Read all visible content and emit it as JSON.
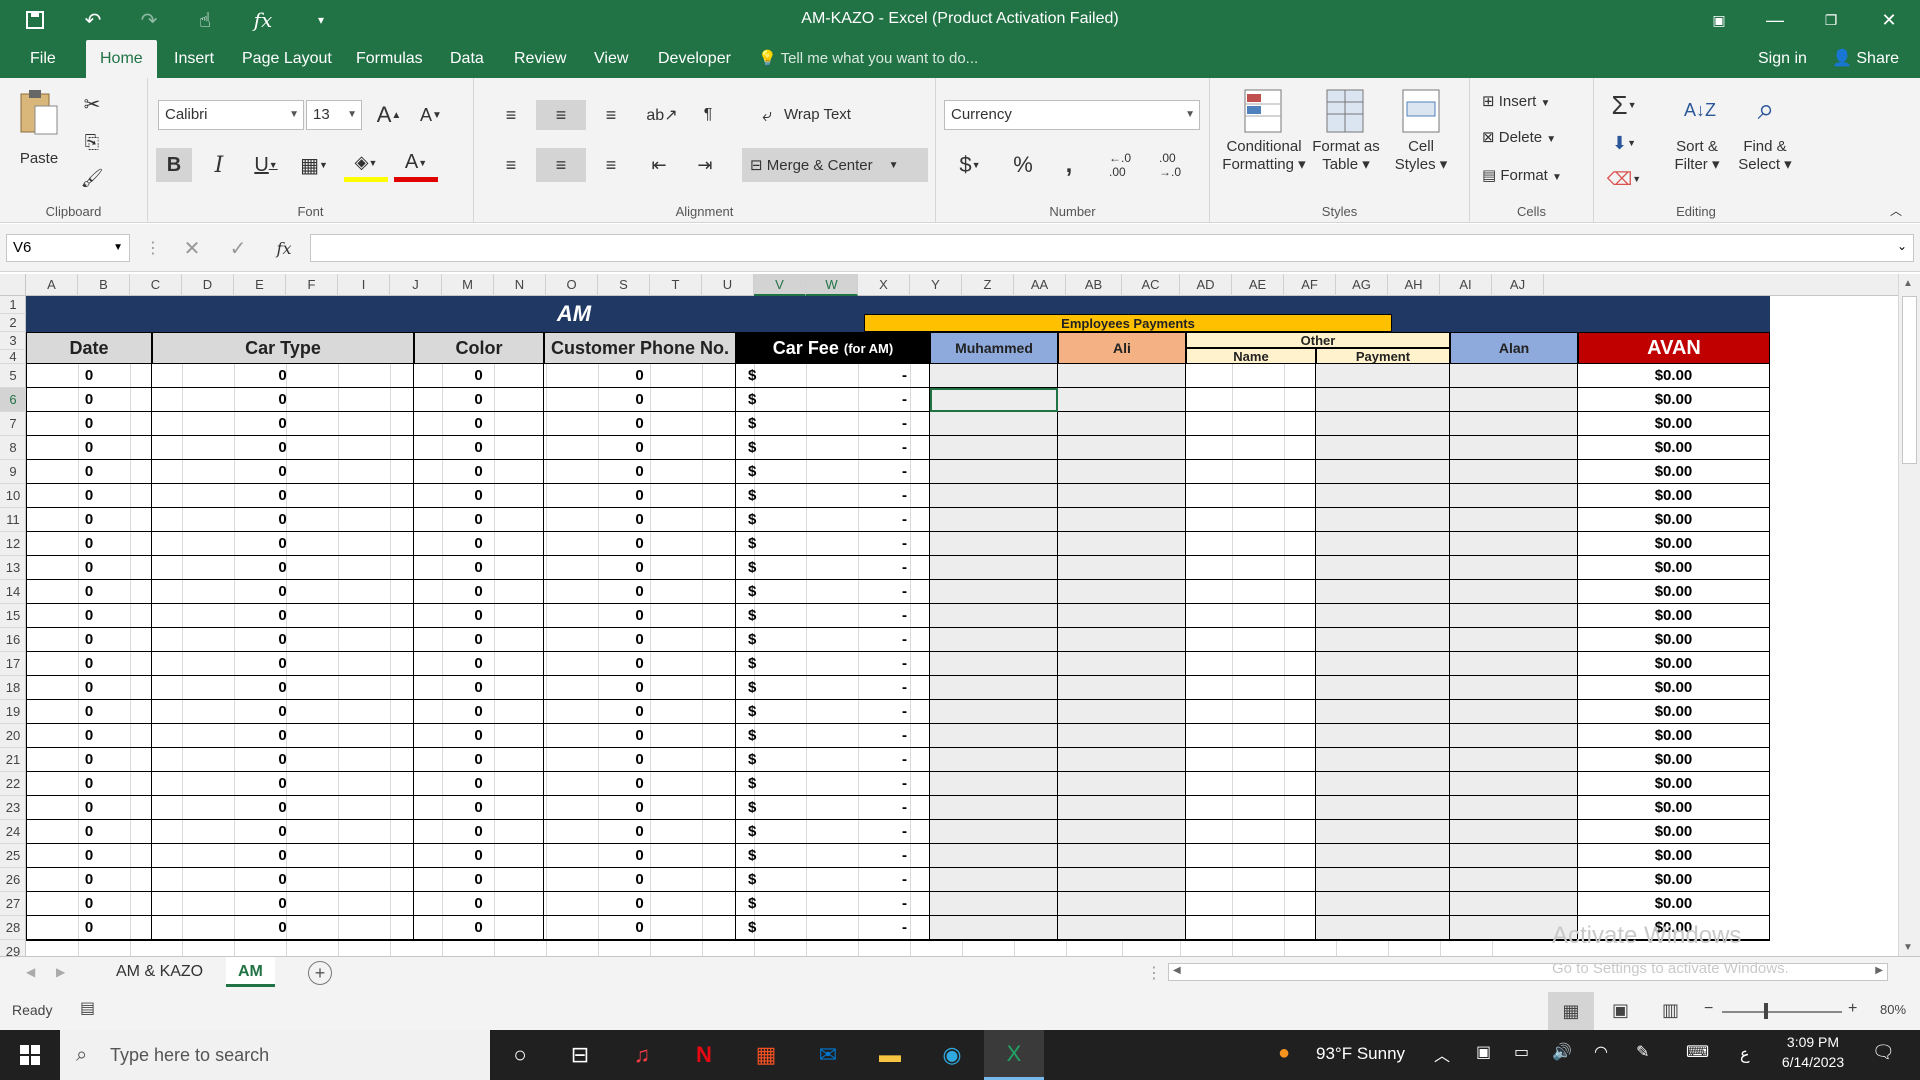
{
  "window": {
    "title": "AM-KAZO - Excel (Product Activation Failed)"
  },
  "ribbon_tabs": [
    {
      "label": "File"
    },
    {
      "label": "Home"
    },
    {
      "label": "Insert"
    },
    {
      "label": "Page Layout"
    },
    {
      "label": "Formulas"
    },
    {
      "label": "Data"
    },
    {
      "label": "Review"
    },
    {
      "label": "View"
    },
    {
      "label": "Developer"
    }
  ],
  "tellme": "Tell me what you want to do...",
  "signin": "Sign in",
  "share": "Share",
  "clipboard": {
    "paste": "Paste",
    "label": "Clipboard"
  },
  "font": {
    "name": "Calibri",
    "size": "13",
    "label": "Font"
  },
  "alignment": {
    "wrap": "Wrap Text",
    "merge": "Merge & Center",
    "label": "Alignment"
  },
  "number": {
    "format": "Currency",
    "label": "Number"
  },
  "styles": {
    "conditional": "Conditional",
    "conditional2": "Formatting",
    "format_as": "Format as",
    "format_as2": "Table",
    "cell": "Cell",
    "cell2": "Styles",
    "label": "Styles"
  },
  "cells_grp": {
    "insert": "Insert",
    "delete": "Delete",
    "format": "Format",
    "label": "Cells"
  },
  "editing": {
    "sort": "Sort &",
    "sort2": "Filter",
    "find": "Find &",
    "find2": "Select",
    "label": "Editing"
  },
  "namebox": "V6",
  "columns": [
    "A",
    "B",
    "C",
    "D",
    "E",
    "F",
    "I",
    "J",
    "M",
    "N",
    "O",
    "S",
    "T",
    "U",
    "V",
    "W",
    "X",
    "Y",
    "Z",
    "AA",
    "AB",
    "AC",
    "AD",
    "AE",
    "AF",
    "AG",
    "AH",
    "AI",
    "AJ"
  ],
  "sheet": {
    "title": "AM",
    "employees": "Employees Payments",
    "headers": {
      "date": "Date",
      "car_type": "Car Type",
      "color": "Color",
      "phone": "Customer Phone No.",
      "car_fee": "Car Fee",
      "car_fee_sub": "(for AM)",
      "muhammed": "Muhammed",
      "ali": "Ali",
      "other": "Other",
      "name": "Name",
      "payment": "Payment",
      "alan": "Alan",
      "avan": "AVAN"
    },
    "zero": "0",
    "dollar": "$",
    "dash": "-",
    "money": "$0.00",
    "rows": [
      5,
      6,
      7,
      8,
      9,
      10,
      11,
      12,
      13,
      14,
      15,
      16,
      17,
      18,
      19,
      20,
      21,
      22,
      23,
      24,
      25,
      26,
      27,
      28
    ]
  },
  "sheet_tabs": [
    {
      "label": "AM & KAZO"
    },
    {
      "label": "AM"
    }
  ],
  "status": {
    "ready": "Ready",
    "zoom": "80%"
  },
  "activation": {
    "line1": "Activate Windows",
    "line2": "Go to Settings to activate Windows."
  },
  "taskbar": {
    "search": "Type here to search",
    "weather": "93°F  Sunny",
    "time": "3:09 PM",
    "date": "6/14/2023",
    "lang": "ع"
  },
  "colors": {
    "excel_green": "#217346",
    "header_navy": "#1f3864",
    "gold": "#ffc000",
    "muh": "#8ea9db",
    "ali": "#f4b183",
    "other": "#fff2cc",
    "avan": "#c00000",
    "gray": "#d9d9d9",
    "light": "#ededed"
  }
}
